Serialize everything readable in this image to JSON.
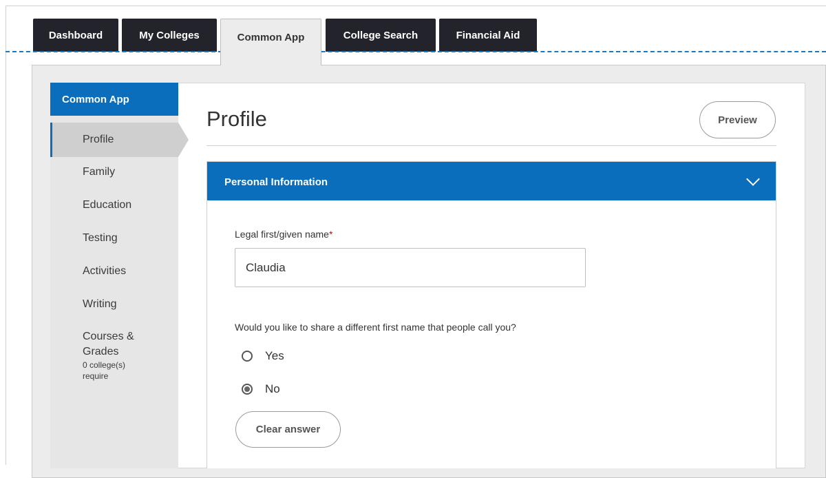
{
  "tabs": [
    {
      "label": "Dashboard"
    },
    {
      "label": "My Colleges"
    },
    {
      "label": "Common App"
    },
    {
      "label": "College Search"
    },
    {
      "label": "Financial Aid"
    }
  ],
  "sidebar": {
    "header": "Common App",
    "items": [
      {
        "label": "Profile"
      },
      {
        "label": "Family"
      },
      {
        "label": "Education"
      },
      {
        "label": "Testing"
      },
      {
        "label": "Activities"
      },
      {
        "label": "Writing"
      },
      {
        "label": "Courses &",
        "label2": "Grades",
        "note1": "0 college(s)",
        "note2": "require"
      }
    ]
  },
  "main": {
    "title": "Profile",
    "preview_label": "Preview",
    "section": {
      "title": "Personal Information",
      "first_name_label": "Legal first/given name",
      "required_marker": "*",
      "first_name_value": "Claudia",
      "question": "Would you like to share a different first name that people call you?",
      "options": [
        {
          "label": "Yes",
          "checked": false
        },
        {
          "label": "No",
          "checked": true
        }
      ],
      "clear_label": "Clear answer"
    }
  },
  "colors": {
    "accent": "#0a6ebd",
    "tab_dark": "#23232b",
    "required": "#d0021b"
  }
}
